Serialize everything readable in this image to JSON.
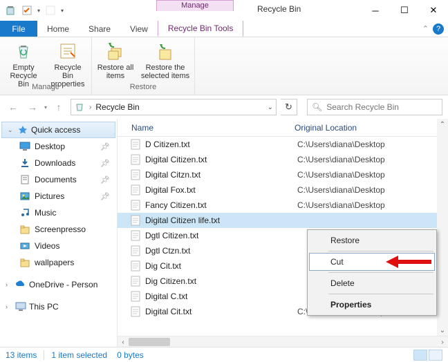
{
  "window": {
    "title": "Recycle Bin",
    "manage_label": "Manage"
  },
  "ribbon_tabs": {
    "file": "File",
    "home": "Home",
    "share": "Share",
    "view": "View",
    "contextual": "Recycle Bin Tools"
  },
  "ribbon": {
    "manage_group": "Manage",
    "restore_group": "Restore",
    "empty": "Empty Recycle Bin",
    "properties": "Recycle Bin properties",
    "restore_all": "Restore all items",
    "restore_sel": "Restore the selected items"
  },
  "nav": {
    "breadcrumb": "Recycle Bin",
    "search_placeholder": "Search Recycle Bin"
  },
  "sidebar": {
    "quick_access": "Quick access",
    "items": [
      {
        "label": "Desktop",
        "pinned": true
      },
      {
        "label": "Downloads",
        "pinned": true
      },
      {
        "label": "Documents",
        "pinned": true
      },
      {
        "label": "Pictures",
        "pinned": true
      },
      {
        "label": "Music",
        "pinned": false
      },
      {
        "label": "Screenpresso",
        "pinned": false
      },
      {
        "label": "Videos",
        "pinned": false
      },
      {
        "label": "wallpapers",
        "pinned": false
      }
    ],
    "onedrive": "OneDrive - Person",
    "this_pc": "This PC"
  },
  "columns": {
    "name": "Name",
    "orig": "Original Location"
  },
  "files": [
    {
      "name": "D Citizen.txt",
      "loc": "C:\\Users\\diana\\Desktop"
    },
    {
      "name": "Digital Citizen.txt",
      "loc": "C:\\Users\\diana\\Desktop"
    },
    {
      "name": "Digital Citzn.txt",
      "loc": "C:\\Users\\diana\\Desktop"
    },
    {
      "name": "Digital Fox.txt",
      "loc": "C:\\Users\\diana\\Desktop"
    },
    {
      "name": "Fancy Citizen.txt",
      "loc": "C:\\Users\\diana\\Desktop"
    },
    {
      "name": "Digital Citizen life.txt",
      "loc": "",
      "selected": true
    },
    {
      "name": "Dgtl Citizen.txt",
      "loc": ""
    },
    {
      "name": "Dgtl Ctzn.txt",
      "loc": ""
    },
    {
      "name": "Dig Cit.txt",
      "loc": ""
    },
    {
      "name": "Dig Citizen.txt",
      "loc": ""
    },
    {
      "name": "Digital C.txt",
      "loc": ""
    },
    {
      "name": "Digital Cit.txt",
      "loc": "C:\\Users\\diana\\Desktop"
    }
  ],
  "context_menu": {
    "restore": "Restore",
    "cut": "Cut",
    "delete": "Delete",
    "properties": "Properties"
  },
  "status": {
    "count": "13 items",
    "selection": "1 item selected",
    "size": "0 bytes"
  }
}
